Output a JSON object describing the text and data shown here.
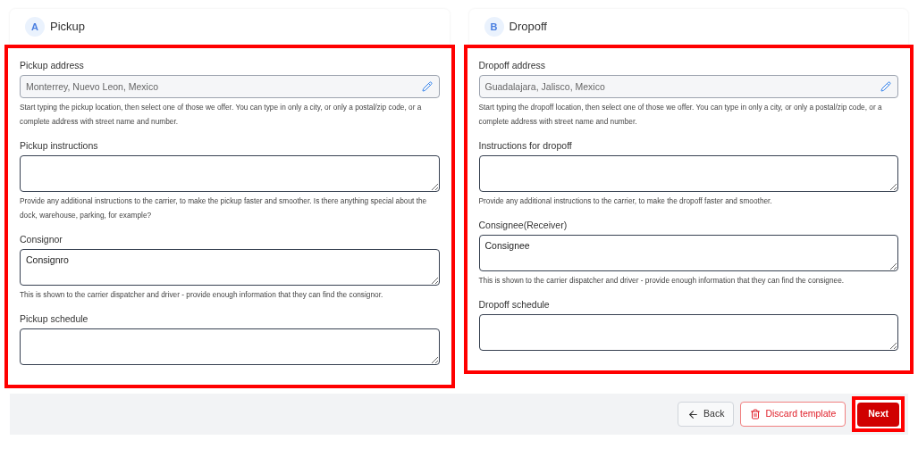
{
  "sections": [
    {
      "badge": "A",
      "title": "Pickup",
      "highlighted": true,
      "fields": [
        {
          "kind": "address",
          "label": "Pickup address",
          "value": "Monterrey, Nuevo Leon, Mexico",
          "help": "Start typing the pickup location, then select one of those we offer. You can type in only a city, or only a postal/zip code, or a complete address with street name and number."
        },
        {
          "kind": "textarea",
          "label": "Pickup instructions",
          "help": "Provide any additional instructions to the carrier, to make the pickup faster and smoother. Is there anything special about the dock, warehouse, parking, for example?"
        },
        {
          "kind": "textarea",
          "label": "Consignor",
          "value": "Consignro",
          "help": "This is shown to the carrier dispatcher and driver - provide enough information that they can find the consignor."
        },
        {
          "kind": "textarea",
          "label": "Pickup schedule"
        }
      ]
    },
    {
      "badge": "B",
      "title": "Dropoff",
      "highlighted": true,
      "fields": [
        {
          "kind": "address",
          "label": "Dropoff address",
          "value": "Guadalajara, Jalisco, Mexico",
          "help": "Start typing the dropoff location, then select one of those we offer. You can type in only a city, or only a postal/zip code, or a complete address with street name and number."
        },
        {
          "kind": "textarea",
          "label": "Instructions for dropoff",
          "help": "Provide any additional instructions to the carrier, to make the dropoff faster and smoother."
        },
        {
          "kind": "textarea",
          "label": "Consignee(Receiver)",
          "value": "Consignee",
          "help": "This is shown to the carrier dispatcher and driver - provide enough information that they can find the consignee."
        },
        {
          "kind": "textarea",
          "label": "Dropoff schedule"
        }
      ]
    }
  ],
  "footer": {
    "back": "Back",
    "discard": "Discard template",
    "next": "Next",
    "next_highlighted": true
  }
}
